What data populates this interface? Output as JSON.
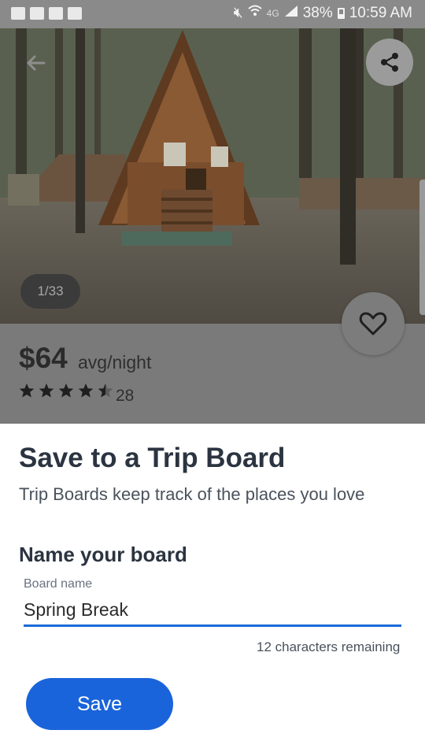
{
  "status_bar": {
    "notification_icons": [
      "message-icon",
      "email-icon",
      "image-icon",
      "outlook-icon"
    ],
    "network": "4G",
    "battery_percent": "38%",
    "time": "10:59 AM"
  },
  "hero": {
    "photo_counter": "1/33",
    "back_icon": "back-arrow-icon",
    "share_icon": "share-icon",
    "favorite_icon": "heart-icon"
  },
  "listing": {
    "price": "$64",
    "price_unit": "avg/night",
    "rating": 4.5,
    "rating_max": 5,
    "review_count": "28"
  },
  "sheet": {
    "title": "Save to a Trip Board",
    "subtitle": "Trip Boards keep track of the places you love",
    "name_heading": "Name your board",
    "field_label": "Board name",
    "field_value": "Spring Break",
    "chars_remaining": "12 characters remaining",
    "save_label": "Save"
  },
  "colors": {
    "primary_blue": "#1a64db",
    "input_underline": "#1a6ad9",
    "heading_text": "#2b3440",
    "dim_overlay": "#7a7a7a"
  }
}
